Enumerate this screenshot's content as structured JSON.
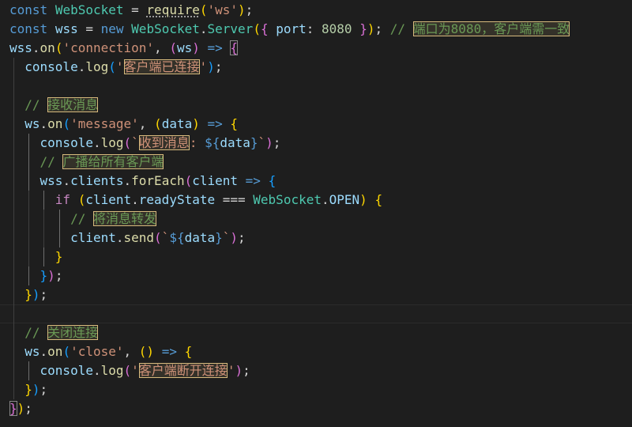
{
  "lines": [
    {
      "guides": [],
      "tokens": [
        {
          "t": "const",
          "c": "kw"
        },
        {
          "t": " "
        },
        {
          "t": "WebSocket",
          "c": "cls"
        },
        {
          "t": " = "
        },
        {
          "t": "require",
          "c": "fn squiggle"
        },
        {
          "t": "(",
          "c": "b1"
        },
        {
          "t": "'ws'",
          "c": "str"
        },
        {
          "t": ")",
          "c": "b1"
        },
        {
          "t": ";"
        }
      ]
    },
    {
      "guides": [],
      "tokens": [
        {
          "t": "const",
          "c": "kw"
        },
        {
          "t": " "
        },
        {
          "t": "wss",
          "c": "var"
        },
        {
          "t": " = "
        },
        {
          "t": "new",
          "c": "kw"
        },
        {
          "t": " "
        },
        {
          "t": "WebSocket",
          "c": "cls"
        },
        {
          "t": "."
        },
        {
          "t": "Server",
          "c": "cls"
        },
        {
          "t": "(",
          "c": "b1"
        },
        {
          "t": "{",
          "c": "b2"
        },
        {
          "t": " "
        },
        {
          "t": "port",
          "c": "var"
        },
        {
          "t": ": "
        },
        {
          "t": "8080",
          "c": "num"
        },
        {
          "t": " "
        },
        {
          "t": "}",
          "c": "b2"
        },
        {
          "t": ")",
          "c": "b1"
        },
        {
          "t": ";"
        },
        {
          "t": " "
        },
        {
          "t": "// ",
          "c": "cmt"
        },
        {
          "t": "端口为8080，客户端需一致",
          "c": "cmt hl"
        }
      ]
    },
    {
      "guides": [],
      "tokens": [
        {
          "t": "wss",
          "c": "var"
        },
        {
          "t": "."
        },
        {
          "t": "on",
          "c": "fn"
        },
        {
          "t": "(",
          "c": "b1"
        },
        {
          "t": "'connection'",
          "c": "str"
        },
        {
          "t": ", "
        },
        {
          "t": "(",
          "c": "b2"
        },
        {
          "t": "ws",
          "c": "var"
        },
        {
          "t": ")",
          "c": "b2"
        },
        {
          "t": " "
        },
        {
          "t": "=>",
          "c": "kw"
        },
        {
          "t": " "
        },
        {
          "t": "{",
          "c": "b2 bm"
        }
      ]
    },
    {
      "guides": [
        2
      ],
      "tokens": [
        {
          "t": "  "
        },
        {
          "t": "console",
          "c": "var"
        },
        {
          "t": "."
        },
        {
          "t": "log",
          "c": "fn"
        },
        {
          "t": "(",
          "c": "b3"
        },
        {
          "t": "'",
          "c": "str"
        },
        {
          "t": "客户端已连接",
          "c": "str hl"
        },
        {
          "t": "'",
          "c": "str"
        },
        {
          "t": ")",
          "c": "b3"
        },
        {
          "t": ";"
        }
      ]
    },
    {
      "guides": [
        2
      ],
      "tokens": []
    },
    {
      "guides": [
        2
      ],
      "tokens": [
        {
          "t": "  "
        },
        {
          "t": "// ",
          "c": "cmt"
        },
        {
          "t": "接收消息",
          "c": "cmt hl"
        }
      ]
    },
    {
      "guides": [
        2
      ],
      "tokens": [
        {
          "t": "  "
        },
        {
          "t": "ws",
          "c": "var"
        },
        {
          "t": "."
        },
        {
          "t": "on",
          "c": "fn"
        },
        {
          "t": "(",
          "c": "b3"
        },
        {
          "t": "'message'",
          "c": "str"
        },
        {
          "t": ", "
        },
        {
          "t": "(",
          "c": "b1"
        },
        {
          "t": "data",
          "c": "var"
        },
        {
          "t": ")",
          "c": "b1"
        },
        {
          "t": " "
        },
        {
          "t": "=>",
          "c": "kw"
        },
        {
          "t": " "
        },
        {
          "t": "{",
          "c": "b1"
        }
      ]
    },
    {
      "guides": [
        2,
        4
      ],
      "tokens": [
        {
          "t": "    "
        },
        {
          "t": "console",
          "c": "var"
        },
        {
          "t": "."
        },
        {
          "t": "log",
          "c": "fn"
        },
        {
          "t": "(",
          "c": "b2"
        },
        {
          "t": "`",
          "c": "str"
        },
        {
          "t": "收到消息",
          "c": "str hl"
        },
        {
          "t": ": ",
          "c": "str"
        },
        {
          "t": "${",
          "c": "kw"
        },
        {
          "t": "data",
          "c": "var"
        },
        {
          "t": "}",
          "c": "kw"
        },
        {
          "t": "`",
          "c": "str"
        },
        {
          "t": ")",
          "c": "b2"
        },
        {
          "t": ";"
        }
      ]
    },
    {
      "guides": [
        2,
        4
      ],
      "tokens": [
        {
          "t": "    "
        },
        {
          "t": "// ",
          "c": "cmt"
        },
        {
          "t": "广播给所有客户端",
          "c": "cmt hl"
        }
      ]
    },
    {
      "guides": [
        2,
        4
      ],
      "tokens": [
        {
          "t": "    "
        },
        {
          "t": "wss",
          "c": "var"
        },
        {
          "t": "."
        },
        {
          "t": "clients",
          "c": "var"
        },
        {
          "t": "."
        },
        {
          "t": "forEach",
          "c": "fn"
        },
        {
          "t": "(",
          "c": "b2"
        },
        {
          "t": "client",
          "c": "var"
        },
        {
          "t": " "
        },
        {
          "t": "=>",
          "c": "kw"
        },
        {
          "t": " "
        },
        {
          "t": "{",
          "c": "b3"
        }
      ]
    },
    {
      "guides": [
        2,
        4,
        6
      ],
      "tokens": [
        {
          "t": "      "
        },
        {
          "t": "if",
          "c": "ctl"
        },
        {
          "t": " "
        },
        {
          "t": "(",
          "c": "b1"
        },
        {
          "t": "client",
          "c": "var"
        },
        {
          "t": "."
        },
        {
          "t": "readyState",
          "c": "var"
        },
        {
          "t": " === "
        },
        {
          "t": "WebSocket",
          "c": "cls"
        },
        {
          "t": "."
        },
        {
          "t": "OPEN",
          "c": "var"
        },
        {
          "t": ")",
          "c": "b1"
        },
        {
          "t": " "
        },
        {
          "t": "{",
          "c": "b1"
        }
      ]
    },
    {
      "guides": [
        2,
        4,
        6,
        8
      ],
      "tokens": [
        {
          "t": "        "
        },
        {
          "t": "// ",
          "c": "cmt"
        },
        {
          "t": "将消息转发",
          "c": "cmt hl"
        }
      ]
    },
    {
      "guides": [
        2,
        4,
        6,
        8
      ],
      "tokens": [
        {
          "t": "        "
        },
        {
          "t": "client",
          "c": "var"
        },
        {
          "t": "."
        },
        {
          "t": "send",
          "c": "fn"
        },
        {
          "t": "(",
          "c": "b2"
        },
        {
          "t": "`",
          "c": "str"
        },
        {
          "t": "${",
          "c": "kw"
        },
        {
          "t": "data",
          "c": "var"
        },
        {
          "t": "}",
          "c": "kw"
        },
        {
          "t": "`",
          "c": "str"
        },
        {
          "t": ")",
          "c": "b2"
        },
        {
          "t": ";"
        }
      ]
    },
    {
      "guides": [
        2,
        4,
        6
      ],
      "tokens": [
        {
          "t": "      "
        },
        {
          "t": "}",
          "c": "b1"
        }
      ]
    },
    {
      "guides": [
        2,
        4
      ],
      "tokens": [
        {
          "t": "    "
        },
        {
          "t": "}",
          "c": "b3"
        },
        {
          "t": ")",
          "c": "b2"
        },
        {
          "t": ";"
        }
      ]
    },
    {
      "guides": [
        2
      ],
      "tokens": [
        {
          "t": "  "
        },
        {
          "t": "}",
          "c": "b1"
        },
        {
          "t": ")",
          "c": "b3"
        },
        {
          "t": ";"
        }
      ]
    },
    {
      "guides": [
        2
      ],
      "current": true,
      "tokens": []
    },
    {
      "guides": [
        2
      ],
      "tokens": [
        {
          "t": "  "
        },
        {
          "t": "// ",
          "c": "cmt"
        },
        {
          "t": "关闭连接",
          "c": "cmt hl"
        }
      ]
    },
    {
      "guides": [
        2
      ],
      "tokens": [
        {
          "t": "  "
        },
        {
          "t": "ws",
          "c": "var"
        },
        {
          "t": "."
        },
        {
          "t": "on",
          "c": "fn"
        },
        {
          "t": "(",
          "c": "b3"
        },
        {
          "t": "'close'",
          "c": "str"
        },
        {
          "t": ", "
        },
        {
          "t": "(",
          "c": "b1"
        },
        {
          "t": ")",
          "c": "b1"
        },
        {
          "t": " "
        },
        {
          "t": "=>",
          "c": "kw"
        },
        {
          "t": " "
        },
        {
          "t": "{",
          "c": "b1"
        }
      ]
    },
    {
      "guides": [
        2,
        4
      ],
      "tokens": [
        {
          "t": "    "
        },
        {
          "t": "console",
          "c": "var"
        },
        {
          "t": "."
        },
        {
          "t": "log",
          "c": "fn"
        },
        {
          "t": "(",
          "c": "b2"
        },
        {
          "t": "'",
          "c": "str"
        },
        {
          "t": "客户端断开连接",
          "c": "str hl"
        },
        {
          "t": "'",
          "c": "str"
        },
        {
          "t": ")",
          "c": "b2"
        },
        {
          "t": ";"
        }
      ]
    },
    {
      "guides": [
        2
      ],
      "tokens": [
        {
          "t": "  "
        },
        {
          "t": "}",
          "c": "b1"
        },
        {
          "t": ")",
          "c": "b3"
        },
        {
          "t": ";"
        }
      ]
    },
    {
      "guides": [],
      "tokens": [
        {
          "t": "}",
          "c": "b2 bm"
        },
        {
          "t": ")",
          "c": "b1"
        },
        {
          "t": ";"
        }
      ]
    }
  ]
}
